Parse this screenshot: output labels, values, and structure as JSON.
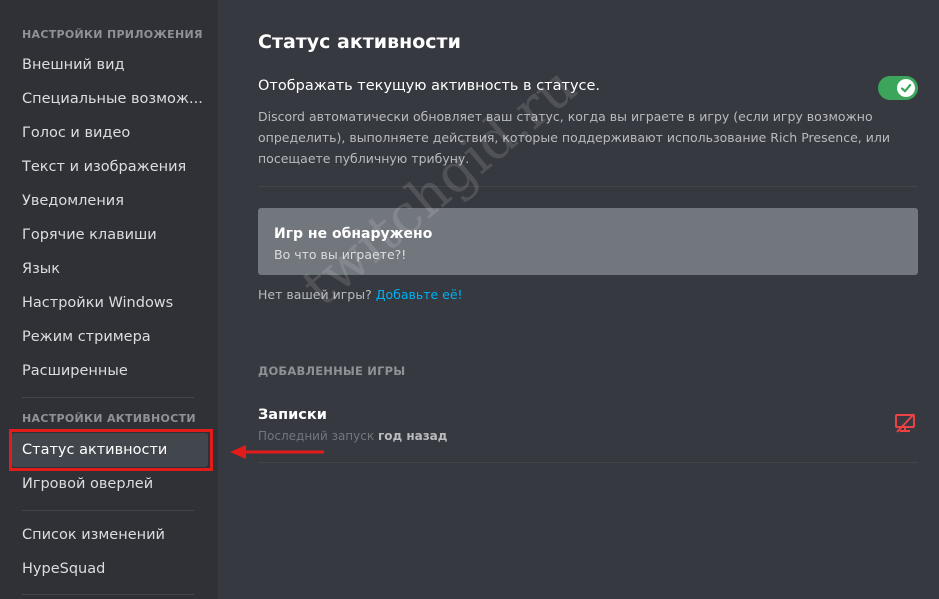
{
  "sidebar": {
    "app_settings_header": "Настройки приложения",
    "app_items": [
      {
        "label": "Внешний вид"
      },
      {
        "label": "Специальные возмож..."
      },
      {
        "label": "Голос и видео"
      },
      {
        "label": "Текст и изображения"
      },
      {
        "label": "Уведомления"
      },
      {
        "label": "Горячие клавиши"
      },
      {
        "label": "Язык"
      },
      {
        "label": "Настройки Windows"
      },
      {
        "label": "Режим стримера"
      },
      {
        "label": "Расширенные"
      }
    ],
    "activity_settings_header": "Настройки активности",
    "activity_items": [
      {
        "label": "Статус активности",
        "selected": true
      },
      {
        "label": "Игровой оверлей"
      }
    ],
    "other_items": [
      {
        "label": "Список изменений"
      },
      {
        "label": "HypeSquad"
      }
    ]
  },
  "main": {
    "title": "Статус активности",
    "toggle": {
      "label": "Отображать текущую активность в статусе.",
      "enabled": true,
      "icon": "check-icon"
    },
    "description": "Discord автоматически обновляет ваш статус, когда вы играете в игру (если игру возможно определить), выполняете действия, которые поддерживают использование Rich Presence, или посещаете публичную трибуну.",
    "no_game": {
      "title": "Игр не обнаружено",
      "subtitle": "Во что вы играете?!"
    },
    "add_prompt": {
      "text": "Нет вашей игры?",
      "link": "Добавьте её!"
    },
    "added_games_header": "Добавленные игры",
    "games": [
      {
        "name": "Записки",
        "last_played_label": "Последний запуск",
        "last_played_value": "год назад",
        "overlay_icon": "overlay-disabled-icon"
      }
    ]
  },
  "watermark": "twitchgid.ru",
  "colors": {
    "sidebar_bg": "#2f3136",
    "content_bg": "#36393f",
    "toggle_on": "#3ba55c",
    "link": "#00b0f4",
    "annotation_red": "#e21b1b",
    "overlay_icon_red": "#ed4245"
  }
}
